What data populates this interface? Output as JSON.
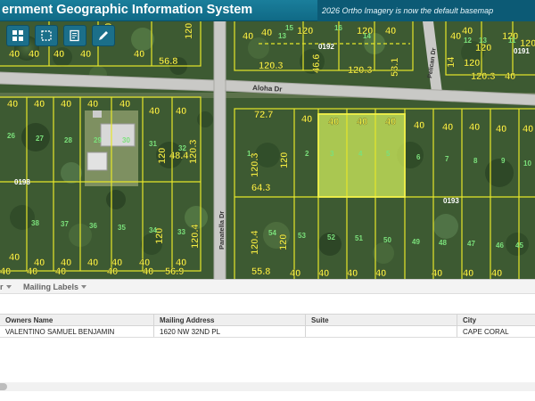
{
  "header": {
    "title": "ernment Geographic Information System",
    "notice": "2026 Ortho Imagery is now the default basemap"
  },
  "colors": {
    "header": "#137591",
    "parcel_line": "#e6e62a",
    "road": "#c9c9c6",
    "vegetation": "#3d5a32",
    "selected_parcel": "#c9e65a",
    "toolbar_button": "#1b6f8a"
  },
  "toolbar": {
    "icons": [
      "grid-icon",
      "selection-box-icon",
      "edit-document-icon",
      "pencil-icon"
    ]
  },
  "map": {
    "roads": {
      "aloha": "Aloha Dr",
      "panatella": "Panatella Dr",
      "pelican": "Pelican Dr"
    },
    "block_numbers": [
      "0192",
      "0191",
      "0198",
      "0193"
    ],
    "dimension_labels": [
      "120",
      "120",
      "40",
      "40",
      "40",
      "56.8",
      "40",
      "40",
      "120",
      "120",
      "40",
      "40",
      "40",
      "40",
      "120",
      "120",
      "120",
      "120",
      "120.3",
      "46.6",
      "120.3",
      "53.1",
      "14",
      "40",
      "120.3",
      "40",
      "40",
      "40",
      "40",
      "40",
      "40",
      "40",
      "40",
      "40",
      "40",
      "40",
      "120",
      "120.3",
      "40",
      "48.4",
      "120.4",
      "120",
      "40",
      "40",
      "40",
      "40",
      "40",
      "40",
      "40",
      "56.9",
      "40",
      "72.7",
      "40",
      "40",
      "40",
      "40",
      "40",
      "40",
      "40",
      "40",
      "40",
      "120.3",
      "120",
      "64.3",
      "120.4",
      "120",
      "55.8",
      "40",
      "40",
      "40",
      "40",
      "40",
      "40",
      "40"
    ],
    "lot_numbers": [
      "15",
      "16",
      "13",
      "14",
      "13",
      "26",
      "27",
      "28",
      "29",
      "30",
      "31",
      "32",
      "38",
      "37",
      "36",
      "35",
      "34",
      "33",
      "1",
      "2",
      "3",
      "4",
      "5",
      "6",
      "7",
      "8",
      "9",
      "10",
      "54",
      "53",
      "52",
      "51",
      "50",
      "49",
      "48",
      "47",
      "46",
      "45",
      "11",
      "12"
    ]
  },
  "panel": {
    "tabs": [
      {
        "label": "r"
      },
      {
        "label": "Mailing Labels"
      }
    ],
    "columns": [
      "Owners Name",
      "Mailing Address",
      "Suite",
      "City"
    ],
    "rows": [
      {
        "owner": "VALENTINO SAMUEL BENJAMIN",
        "address": "1620 NW 32ND PL",
        "suite": "",
        "city": "CAPE CORAL"
      }
    ]
  }
}
